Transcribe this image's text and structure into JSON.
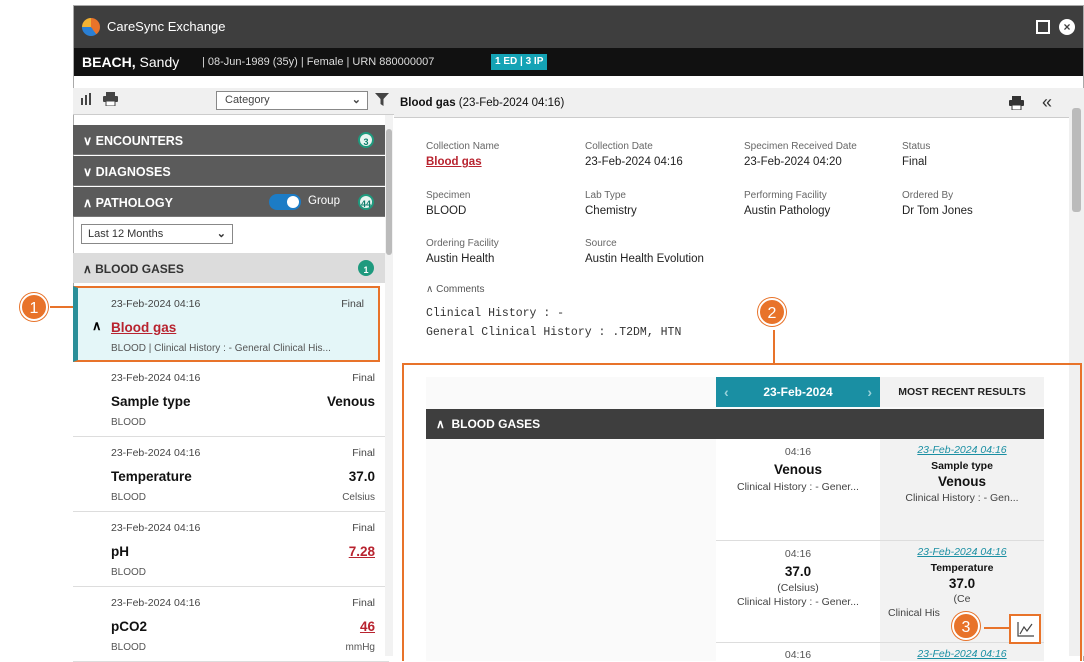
{
  "window": {
    "title": "CareSync Exchange"
  },
  "patient": {
    "surname": "BEACH,",
    "given": " Sandy",
    "info": "|  08-Jun-1989 (35y)  |  Female  |  URN 880000007",
    "encounters": "1 ED | 3 IP"
  },
  "left": {
    "category": "Category",
    "sections": [
      {
        "label": "ENCOUNTERS",
        "count": "3"
      },
      {
        "label": "DIAGNOSES"
      },
      {
        "label": "PATHOLOGY",
        "group": "Group",
        "count": "44"
      }
    ],
    "range": "Last 12 Months",
    "subgroup": {
      "label": "BLOOD GASES",
      "count": "1"
    },
    "items": [
      {
        "date": "23-Feb-2024 04:16",
        "status": "Final",
        "name": "Blood gas",
        "value": "",
        "specimen": "BLOOD | Clinical History : - General Clinical His...",
        "unit": ""
      },
      {
        "date": "23-Feb-2024 04:16",
        "status": "Final",
        "name": "Sample type",
        "value": "Venous",
        "specimen": "BLOOD",
        "unit": ""
      },
      {
        "date": "23-Feb-2024 04:16",
        "status": "Final",
        "name": "Temperature",
        "value": "37.0",
        "specimen": "BLOOD",
        "unit": "Celsius"
      },
      {
        "date": "23-Feb-2024 04:16",
        "status": "Final",
        "name": "pH",
        "value": "7.28",
        "specimen": "BLOOD",
        "unit": ""
      },
      {
        "date": "23-Feb-2024 04:16",
        "status": "Final",
        "name": "pCO2",
        "value": "46",
        "specimen": "BLOOD",
        "unit": "mmHg"
      }
    ]
  },
  "detail": {
    "title_bold": "Blood gas",
    "title_rest": " (23-Feb-2024 04:16)",
    "fields": [
      {
        "k": "Collection Name",
        "v": "Blood gas"
      },
      {
        "k": "Collection Date",
        "v": "23-Feb-2024 04:16"
      },
      {
        "k": "Specimen Received Date",
        "v": "23-Feb-2024 04:20"
      },
      {
        "k": "Status",
        "v": "Final"
      },
      {
        "k": "Specimen",
        "v": "BLOOD"
      },
      {
        "k": "Lab Type",
        "v": "Chemistry"
      },
      {
        "k": "Performing Facility",
        "v": "Austin Pathology"
      },
      {
        "k": "Ordered By",
        "v": "Dr Tom Jones"
      },
      {
        "k": "Ordering Facility",
        "v": "Austin Health"
      },
      {
        "k": "Source",
        "v": "Austin Health Evolution"
      }
    ],
    "comments_label": "Comments",
    "comments": [
      "Clinical History : -",
      "General Clinical History : .T2DM, HTN"
    ]
  },
  "results": {
    "date": "23-Feb-2024",
    "most_recent": "MOST RECENT RESULTS",
    "group": "BLOOD GASES",
    "rows": [
      {
        "time": "04:16",
        "value": "Venous",
        "unit": "",
        "note": "Clinical History : - Gener...",
        "recent_date": "23-Feb-2024 04:16",
        "recent_name": "Sample type",
        "recent_value": "Venous",
        "recent_unit": "",
        "recent_note": "Clinical History : - Gen..."
      },
      {
        "time": "04:16",
        "value": "37.0",
        "unit": "(Celsius)",
        "note": "Clinical History : - Gener...",
        "recent_date": "23-Feb-2024 04:16",
        "recent_name": "Temperature",
        "recent_value": "37.0",
        "recent_unit": "(Ce",
        "recent_note": "Clinical His"
      },
      {
        "time": "04:16",
        "recent_date": "23-Feb-2024 04:16"
      }
    ]
  },
  "callouts": [
    "1",
    "2",
    "3"
  ],
  "colors": {
    "accent": "#e8732a",
    "teal": "#1a8fa3",
    "dark": "#3e3e3e",
    "red": "#b8232f"
  }
}
